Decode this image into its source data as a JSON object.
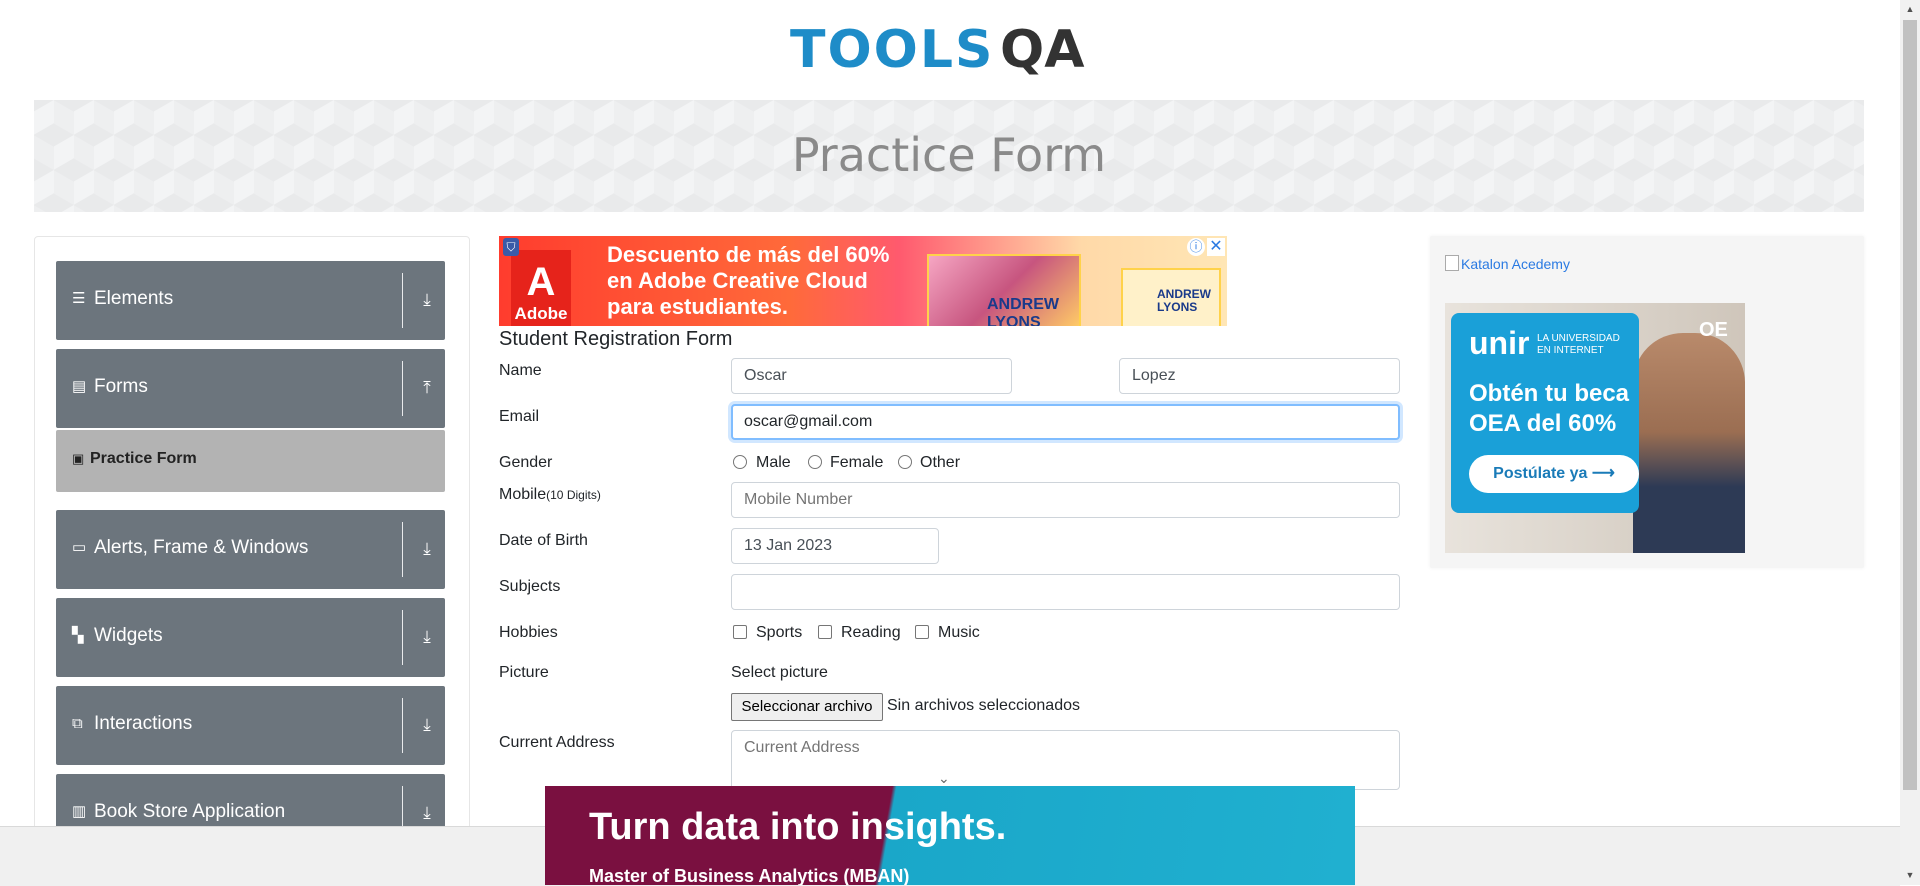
{
  "header": {
    "logo_text": "TOOLS",
    "logo_qa": "QA"
  },
  "banner": {
    "title": "Practice Form"
  },
  "sidebar": {
    "groups": [
      {
        "label": "Elements",
        "icon": "hamburger-icon",
        "arrow": "download-arrow-icon"
      },
      {
        "label": "Forms",
        "icon": "document-icon",
        "arrow": "upload-arrow-icon"
      },
      {
        "label": "Alerts, Frame & Windows",
        "icon": "window-icon",
        "arrow": "download-arrow-icon"
      },
      {
        "label": "Widgets",
        "icon": "widgets-icon",
        "arrow": "download-arrow-icon"
      },
      {
        "label": "Interactions",
        "icon": "interactions-icon",
        "arrow": "download-arrow-icon"
      },
      {
        "label": "Book Store Application",
        "icon": "books-icon",
        "arrow": "download-arrow-icon"
      }
    ],
    "sub_item": {
      "label": "Practice Form",
      "icon": "form-icon"
    }
  },
  "ad_top": {
    "brand": "Adobe",
    "line1": "Descuento de más del 60%",
    "line2": "en Adobe Creative Cloud",
    "line3": "para estudiantes.",
    "name1a": "ANDREW",
    "name1b": "LYONS",
    "name2a": "ANDREW",
    "name2b": "LYONS"
  },
  "form": {
    "title": "Student Registration Form",
    "labels": {
      "name": "Name",
      "email": "Email",
      "gender": "Gender",
      "mobile": "Mobile",
      "mobile_hint": "(10 Digits)",
      "dob": "Date of Birth",
      "subjects": "Subjects",
      "hobbies": "Hobbies",
      "picture": "Picture",
      "address": "Current Address"
    },
    "first_name": "Oscar",
    "last_name": "Lopez",
    "email": "oscar@gmail.com",
    "gender_options": [
      "Male",
      "Female",
      "Other"
    ],
    "mobile_placeholder": "Mobile Number",
    "dob": "13 Jan 2023",
    "subjects": "",
    "hobbies": [
      "Sports",
      "Reading",
      "Music"
    ],
    "picture_caption": "Select picture",
    "file_button": "Seleccionar archivo",
    "file_status": "Sin archivos seleccionados",
    "address_placeholder": "Current Address"
  },
  "right_ad": {
    "alt_text": "Katalon Acedemy",
    "unir_logo": "unir",
    "unir_sub1": "LA UNIVERSIDAD",
    "unir_sub2": "EN INTERNET",
    "unir_head1": "Obtén tu beca",
    "unir_head2": "OEA del 60%",
    "unir_button": "Postúlate ya ⟶",
    "unir_oe": "OE"
  },
  "bottom_ad": {
    "headline": "Turn data into insights.",
    "subline": "Master of Business Analytics (MBAN)"
  }
}
